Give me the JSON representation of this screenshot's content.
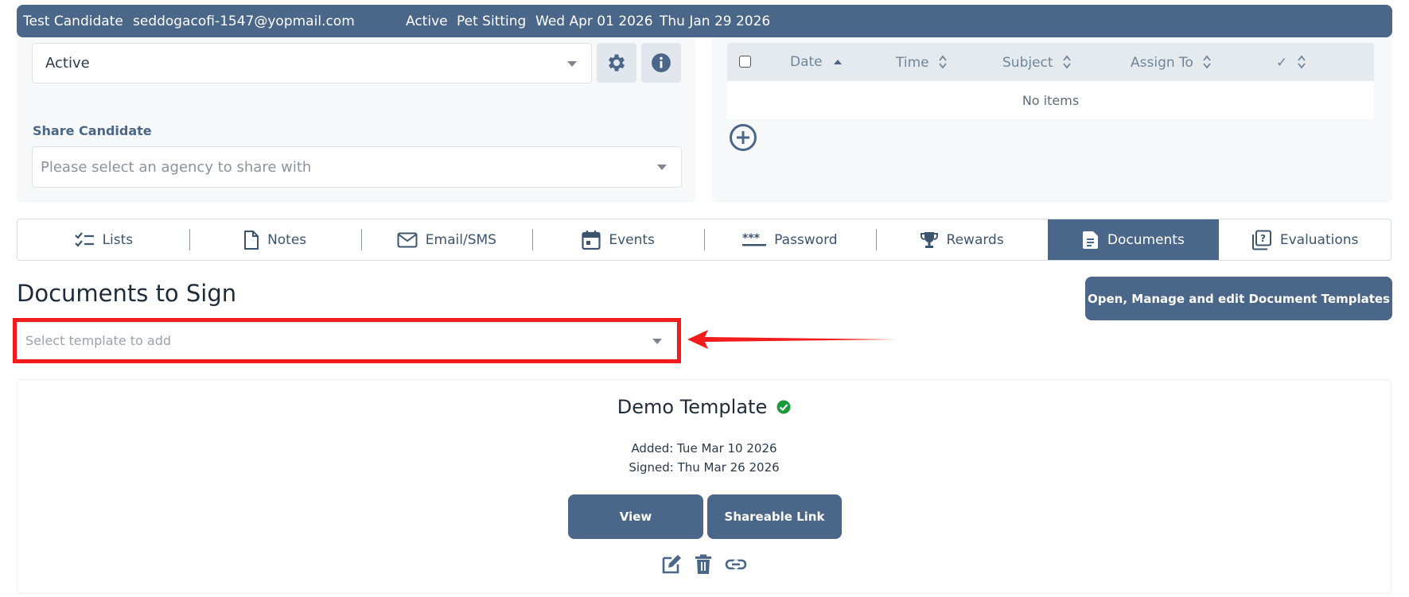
{
  "header": {
    "name": "Test Candidate",
    "email": "seddogacofi-1547@yopmail.com",
    "status": "Active",
    "job": "Pet Sitting",
    "date1": "Wed Apr 01 2026",
    "date2": "Thu Jan 29 2026"
  },
  "status_select": {
    "value": "Active"
  },
  "share": {
    "label": "Share Candidate",
    "placeholder": "Please select an agency to share with"
  },
  "tasks_table": {
    "columns": [
      "Date",
      "Time",
      "Subject",
      "Assign To",
      "✓"
    ],
    "empty_text": "No items"
  },
  "tabs": [
    {
      "label": "Lists",
      "icon": "checklist-icon"
    },
    {
      "label": "Notes",
      "icon": "file-icon"
    },
    {
      "label": "Email/SMS",
      "icon": "envelope-icon"
    },
    {
      "label": "Events",
      "icon": "calendar-icon"
    },
    {
      "label": "Password",
      "icon": "password-icon"
    },
    {
      "label": "Rewards",
      "icon": "trophy-icon"
    },
    {
      "label": "Documents",
      "icon": "document-icon",
      "active": true
    },
    {
      "label": "Evaluations",
      "icon": "evaluation-icon"
    }
  ],
  "documents": {
    "title": "Documents to Sign",
    "manage_button": "Open, Manage and edit Document Templates",
    "template_placeholder": "Select template to add"
  },
  "template_card": {
    "name": "Demo Template",
    "added": "Added: Tue Mar 10 2026",
    "signed": "Signed: Thu Mar 26 2026",
    "view_button": "View",
    "link_button": "Shareable Link"
  },
  "colors": {
    "primary": "#4a6688",
    "highlight": "#f21c1c",
    "success": "#1a9a3a"
  }
}
